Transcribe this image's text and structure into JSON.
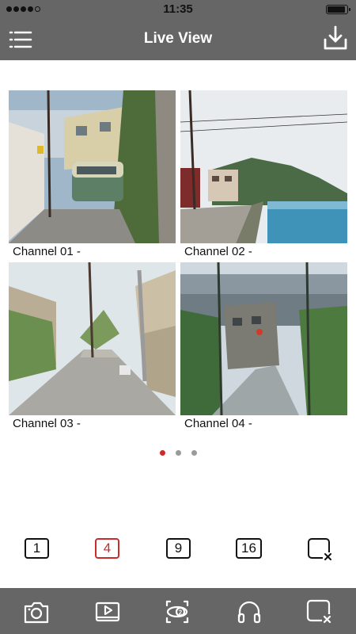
{
  "status_bar": {
    "time": "11:35"
  },
  "header": {
    "title": "Live View",
    "menu_icon": "list-menu-icon",
    "download_icon": "download-icon"
  },
  "channels": [
    {
      "label": "Channel 01 -"
    },
    {
      "label": "Channel 02 -"
    },
    {
      "label": "Channel 03 -"
    },
    {
      "label": "Channel 04 -"
    }
  ],
  "pagination": {
    "pages": 3,
    "current": 1
  },
  "layout_options": [
    {
      "label": "1"
    },
    {
      "label": "4",
      "active": true
    },
    {
      "label": "9"
    },
    {
      "label": "16"
    }
  ],
  "layout_close_icon": "close-window-icon",
  "toolbar": {
    "items": [
      "snapshot-camera-icon",
      "playback-video-icon",
      "ptz-control-icon",
      "audio-headphones-icon",
      "close-all-icon"
    ]
  },
  "colors": {
    "bar": "#666666",
    "accent": "#cc2b2b",
    "dot_inactive": "#9a9a9a"
  }
}
